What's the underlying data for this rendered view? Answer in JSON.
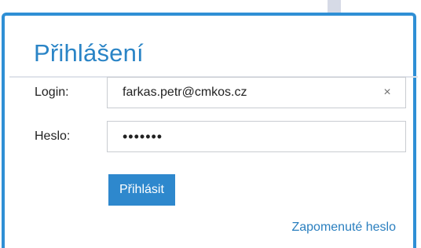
{
  "login_form": {
    "title": "Přihlášení",
    "login_label": "Login:",
    "login_value": "farkas.petr@cmkos.cz",
    "clear_glyph": "×",
    "password_label": "Heslo:",
    "password_value": "•••••••",
    "submit_label": "Přihlásit",
    "forgot_link": "Zapomenuté heslo"
  },
  "colors": {
    "accent": "#2f8fd5",
    "title": "#2a84c6",
    "button_bg": "#2e88cd",
    "link": "#2a7fbf"
  },
  "icons": {
    "clear": "close-icon"
  }
}
